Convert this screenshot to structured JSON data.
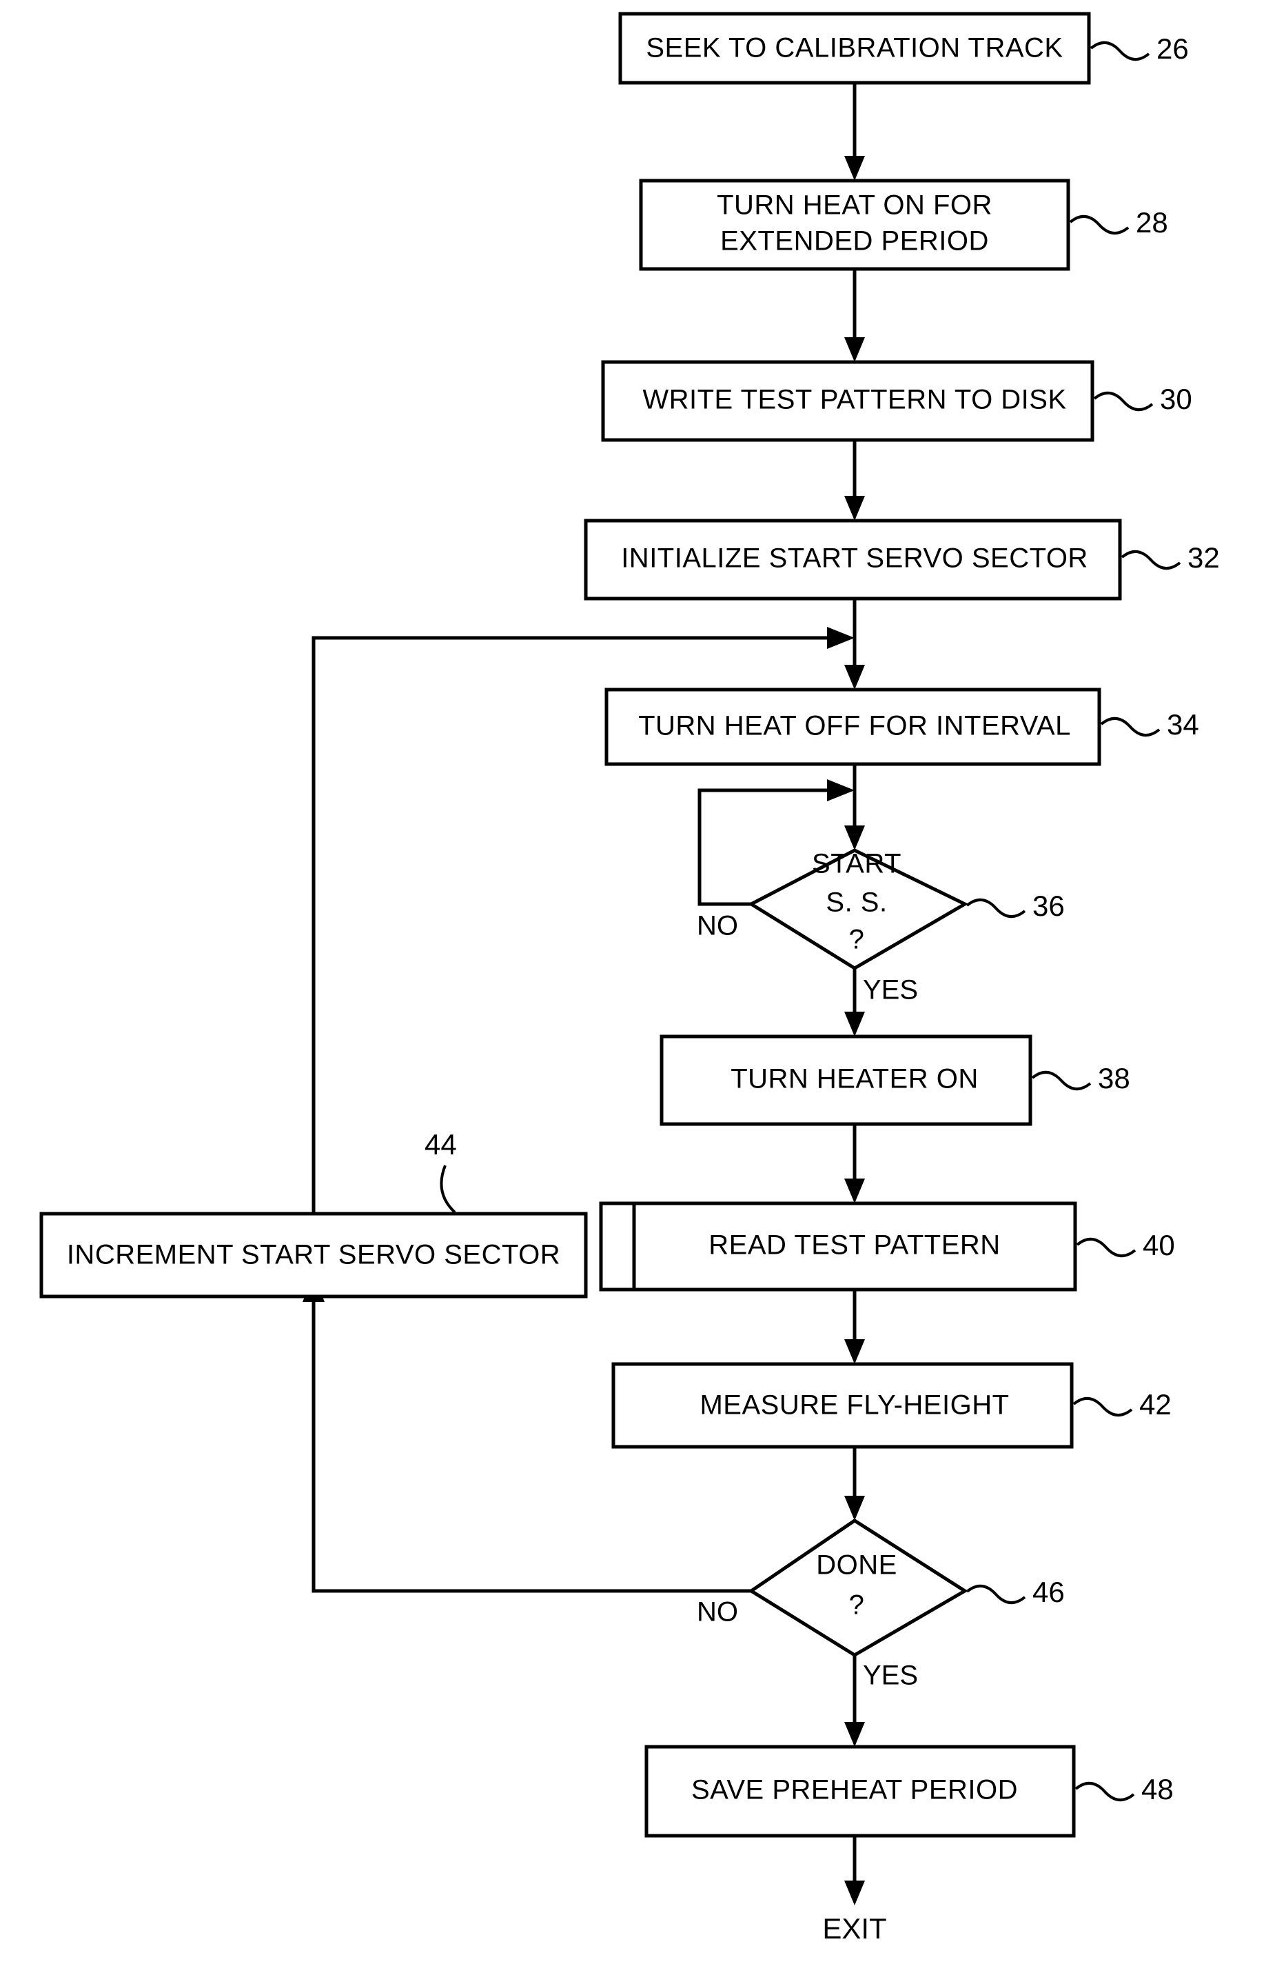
{
  "figure": {
    "type": "patent-flowchart",
    "title": "",
    "terminal_label": "EXIT"
  },
  "nodes": [
    {
      "id": "n26",
      "shape": "process",
      "lines": [
        "SEEK TO CALIBRATION TRACK"
      ],
      "ref": "26"
    },
    {
      "id": "n28",
      "shape": "process",
      "lines": [
        "TURN HEAT ON FOR",
        "EXTENDED PERIOD"
      ],
      "ref": "28"
    },
    {
      "id": "n30",
      "shape": "process",
      "lines": [
        "WRITE TEST PATTERN TO DISK"
      ],
      "ref": "30"
    },
    {
      "id": "n32",
      "shape": "process",
      "lines": [
        "INITIALIZE START SERVO SECTOR"
      ],
      "ref": "32"
    },
    {
      "id": "n34",
      "shape": "process",
      "lines": [
        "TURN HEAT OFF FOR INTERVAL"
      ],
      "ref": "34"
    },
    {
      "id": "n36",
      "shape": "decision",
      "lines": [
        "START",
        "S. S.",
        "?"
      ],
      "ref": "36"
    },
    {
      "id": "n38",
      "shape": "process",
      "lines": [
        "TURN HEATER ON"
      ],
      "ref": "38"
    },
    {
      "id": "n40",
      "shape": "process",
      "lines": [
        "READ TEST PATTERN"
      ],
      "ref": "40"
    },
    {
      "id": "n42",
      "shape": "process",
      "lines": [
        "MEASURE FLY-HEIGHT"
      ],
      "ref": "42"
    },
    {
      "id": "n44",
      "shape": "process",
      "lines": [
        "INCREMENT START SERVO SECTOR"
      ],
      "ref": "44"
    },
    {
      "id": "n46",
      "shape": "decision",
      "lines": [
        "DONE",
        "?"
      ],
      "ref": "46"
    },
    {
      "id": "n48",
      "shape": "process",
      "lines": [
        "SAVE PREHEAT PERIOD"
      ],
      "ref": "48"
    }
  ],
  "labels": {
    "n26_text": "SEEK TO CALIBRATION TRACK",
    "n28_text_1": "TURN HEAT ON FOR",
    "n28_text_2": "EXTENDED PERIOD",
    "n30_text": "WRITE TEST PATTERN TO DISK",
    "n32_text": "INITIALIZE START SERVO SECTOR",
    "n34_text": "TURN HEAT OFF FOR INTERVAL",
    "n36_text_1": "START",
    "n36_text_2": "S. S.",
    "n36_text_3": "?",
    "n38_text": "TURN HEATER ON",
    "n40_text": "READ TEST PATTERN",
    "n42_text": "MEASURE FLY-HEIGHT",
    "n44_text": "INCREMENT START SERVO SECTOR",
    "n46_text_1": "DONE",
    "n46_text_2": "?",
    "n48_text": "SAVE PREHEAT PERIOD",
    "exit_text": "EXIT"
  },
  "refs": {
    "r26": "26",
    "r28": "28",
    "r30": "30",
    "r32": "32",
    "r34": "34",
    "r36": "36",
    "r38": "38",
    "r40": "40",
    "r42": "42",
    "r44": "44",
    "r46": "46",
    "r48": "48"
  },
  "edge_labels": {
    "no_36": "NO",
    "yes_36": "YES",
    "no_46": "NO",
    "yes_46": "YES"
  },
  "colors": {
    "stroke": "#000000",
    "fill": "#ffffff",
    "background": "#ffffff"
  }
}
